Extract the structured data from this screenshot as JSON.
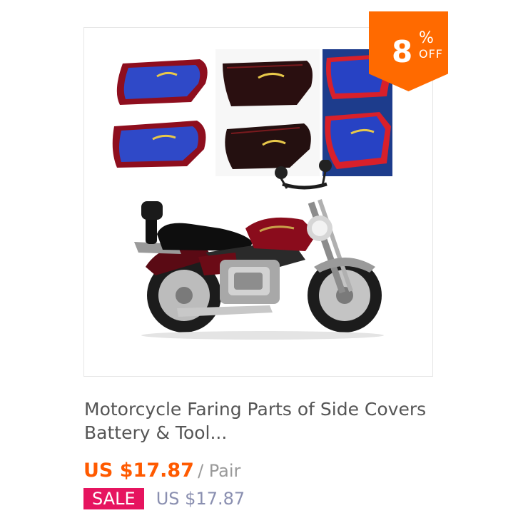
{
  "product": {
    "title_line1": "Motorcycle Faring Parts of Side Covers",
    "title_line2": "Battery & Tool...",
    "price": "US $17.87",
    "unit": "/ Pair",
    "sale_label": "SALE",
    "original_price": "US $17.87"
  },
  "discount_badge": {
    "number": "8",
    "percent_sign": "%",
    "off_label": "OFF",
    "color": "#ff6a00"
  },
  "colors": {
    "price": "#ff5a00",
    "sale_badge": "#e6145f",
    "cover_red": "#8e0e1e",
    "cover_blue": "#2f49c8"
  }
}
